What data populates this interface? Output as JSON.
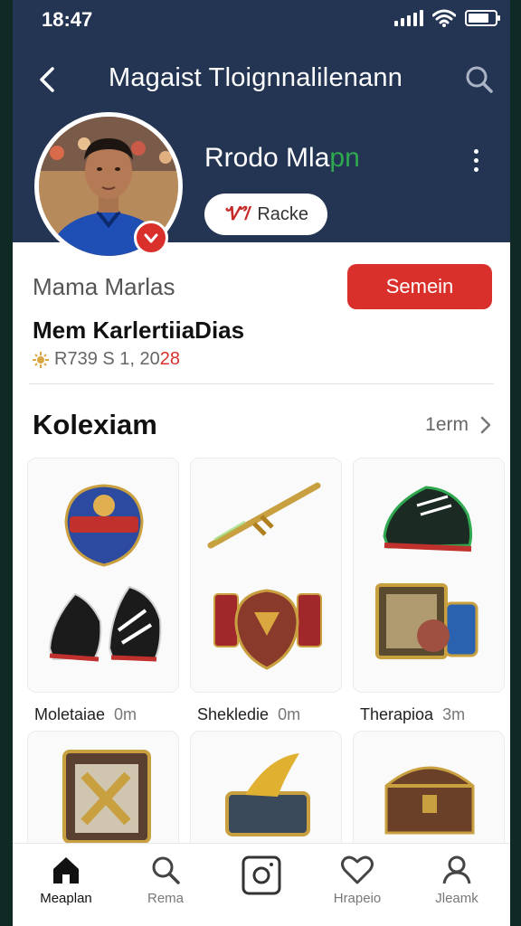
{
  "status": {
    "time": "18:47",
    "battery_level": 0.8
  },
  "nav": {
    "title": "Magaist Tloignnalilenann"
  },
  "profile": {
    "name_main": "Rrodo Mla",
    "name_accent": "pn",
    "tag_icon": "Ꮙ/",
    "tag_text": "Racke"
  },
  "info": {
    "label": "Mama Marlas",
    "button": "Semein",
    "heading": "Mem KarlertiiaDias",
    "date_main": "R739 S  1,  20",
    "date_accent": "28"
  },
  "collection": {
    "title": "Kolexiam",
    "more": "1erm",
    "items": [
      {
        "name": "Moletaiae",
        "duration": "0m"
      },
      {
        "name": "Shekledie",
        "duration": "0m"
      },
      {
        "name": "Therapioa",
        "duration": "3m"
      }
    ]
  },
  "tabs": [
    {
      "label": "Meaplan",
      "icon": "home-icon"
    },
    {
      "label": "Rema",
      "icon": "search-icon"
    },
    {
      "label": "",
      "icon": "camera-icon"
    },
    {
      "label": "Hrapeio",
      "icon": "heart-icon"
    },
    {
      "label": "Jleamk",
      "icon": "profile-icon"
    }
  ],
  "colors": {
    "header": "#243553",
    "accent": "#d9302c",
    "green": "#2fa84f"
  }
}
